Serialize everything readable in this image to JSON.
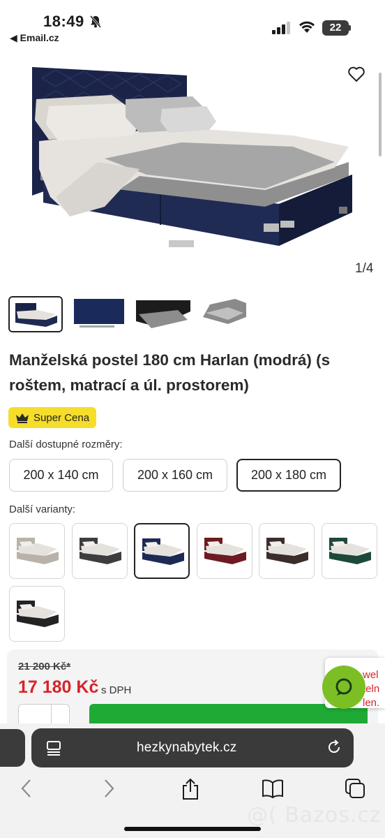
{
  "status_bar": {
    "time": "18:49",
    "back_app": "◀ Email.cz",
    "battery": "22"
  },
  "gallery": {
    "counter": "1/4",
    "thumbnails": [
      "thumb-bed-navy",
      "thumb-fabric-swatch",
      "thumb-storage-detail",
      "thumb-storage-open"
    ]
  },
  "product": {
    "title": "Manželská postel 180 cm Harlan (modrá) (s roštem, matrací a úl. prostorem)",
    "badge": "Super Cena",
    "sizes_label": "Další dostupné rozměry:",
    "sizes": [
      {
        "label": "200 x 140 cm",
        "selected": false
      },
      {
        "label": "200 x 160 cm",
        "selected": false
      },
      {
        "label": "200 x 180 cm",
        "selected": true
      }
    ],
    "variants_label": "Další varianty:",
    "variants": [
      {
        "name": "light grey",
        "color": "#b9b2a8"
      },
      {
        "name": "dark grey",
        "color": "#3d3d3d"
      },
      {
        "name": "navy",
        "color": "#1d2a55"
      },
      {
        "name": "burgundy",
        "color": "#6e1a22"
      },
      {
        "name": "brown",
        "color": "#3b2e2a"
      },
      {
        "name": "green",
        "color": "#1c4a3a"
      },
      {
        "name": "black",
        "color": "#232323"
      }
    ],
    "selected_variant": 2
  },
  "price": {
    "old": "21 200 Kč*",
    "new": "17 180 Kč",
    "vat": "s DPH"
  },
  "chat": {
    "lines": [
      "wel",
      "teln",
      "len."
    ]
  },
  "browser": {
    "url": "hezkynabytek.cz"
  },
  "watermark": "@( Bazos.cz",
  "colors": {
    "accent_red": "#d8232a",
    "buy_green": "#1faa36",
    "badge_yellow": "#f6dd2a",
    "chat_green": "#7cbf25"
  }
}
